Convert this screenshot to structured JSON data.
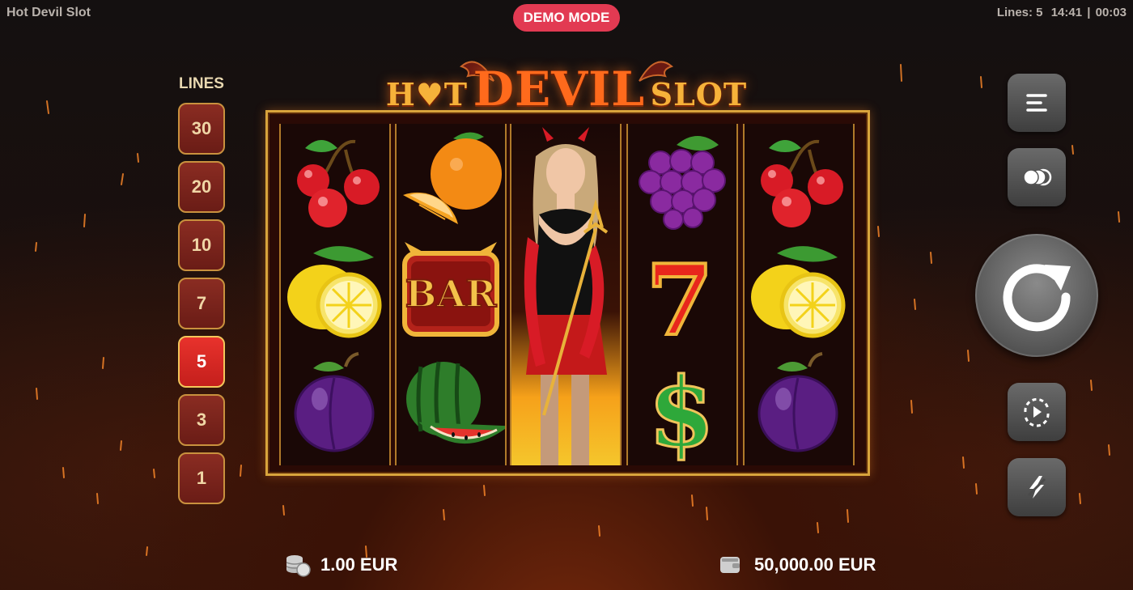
{
  "app_title": "Hot Devil Slot",
  "status": {
    "lines": "Lines: 5",
    "clock": "14:41",
    "session": "00:03",
    "sep": "|"
  },
  "demo_badge": "DEMO MODE",
  "logo": {
    "hot": "H♥T",
    "devil": "DEVIL",
    "slot": "SLOT"
  },
  "lines_panel": {
    "title": "LINES",
    "options": [
      "30",
      "20",
      "10",
      "7",
      "5",
      "3",
      "1"
    ],
    "selected": "5"
  },
  "reels": [
    [
      "cherry",
      "lemon",
      "plum"
    ],
    [
      "orange",
      "bar",
      "watermelon"
    ],
    [
      "devil-girl-wild",
      "devil-girl-wild",
      "devil-girl-wild"
    ],
    [
      "grapes",
      "seven",
      "dollar"
    ],
    [
      "cherry",
      "lemon",
      "plum"
    ]
  ],
  "symbol_text": {
    "bar": "BAR",
    "seven": "7",
    "dollar": "$"
  },
  "controls": {
    "menu": "menu-icon",
    "coins": "coins-icon",
    "spin": "spin-icon",
    "autoplay": "autoplay-icon",
    "turbo": "turbo-icon"
  },
  "bet": {
    "icon": "coin-stack-icon",
    "value": "1.00 EUR"
  },
  "balance": {
    "icon": "wallet-icon",
    "value": "50,000.00 EUR"
  },
  "colors": {
    "accent": "#e23a52",
    "frame_gold": "#d8a43c",
    "line_active": "#e8322c"
  }
}
